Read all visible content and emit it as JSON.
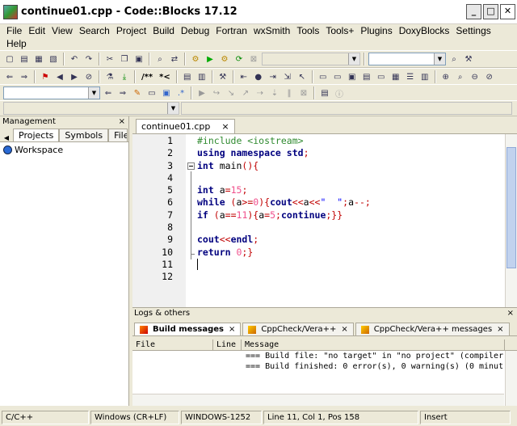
{
  "window": {
    "title": "continue01.cpp - Code::Blocks 17.12",
    "min": "_",
    "max": "□",
    "close": "✕"
  },
  "menu": [
    "File",
    "Edit",
    "View",
    "Search",
    "Project",
    "Build",
    "Debug",
    "Fortran",
    "wxSmith",
    "Tools",
    "Tools+",
    "Plugins",
    "DoxyBlocks",
    "Settings",
    "Help"
  ],
  "toolbar": {
    "doxy_comment_label": "/**",
    "doxy_line_label": "*<"
  },
  "management": {
    "title": "Management",
    "close": "×",
    "tabs": [
      "Projects",
      "Symbols",
      "File"
    ],
    "workspace_label": "Workspace"
  },
  "editor": {
    "tab_label": "continue01.cpp",
    "tab_close": "×",
    "lines": [
      {
        "num": "1",
        "tokens": [
          {
            "t": "#include <iostream>",
            "c": "pp"
          }
        ]
      },
      {
        "num": "2",
        "tokens": [
          {
            "t": "using namespace ",
            "c": "kw"
          },
          {
            "t": "std",
            "c": "kw"
          },
          {
            "t": ";",
            "c": "op"
          }
        ]
      },
      {
        "num": "3",
        "tokens": [
          {
            "t": "int",
            "c": "kw"
          },
          {
            "t": " main",
            "c": "id"
          },
          {
            "t": "(){",
            "c": "op"
          }
        ]
      },
      {
        "num": "4",
        "tokens": []
      },
      {
        "num": "5",
        "tokens": [
          {
            "t": "int",
            "c": "kw"
          },
          {
            "t": " a",
            "c": "id"
          },
          {
            "t": "=",
            "c": "op"
          },
          {
            "t": "15",
            "c": "num"
          },
          {
            "t": ";",
            "c": "op"
          }
        ]
      },
      {
        "num": "6",
        "tokens": [
          {
            "t": "while",
            "c": "kw"
          },
          {
            "t": " (",
            "c": "op"
          },
          {
            "t": "a",
            "c": "id"
          },
          {
            "t": ">=",
            "c": "op"
          },
          {
            "t": "0",
            "c": "num"
          },
          {
            "t": "){",
            "c": "op"
          },
          {
            "t": "cout",
            "c": "kw"
          },
          {
            "t": "<<",
            "c": "op"
          },
          {
            "t": "a",
            "c": "id"
          },
          {
            "t": "<<",
            "c": "op"
          },
          {
            "t": "\"  \"",
            "c": "str"
          },
          {
            "t": ";",
            "c": "op"
          },
          {
            "t": "a",
            "c": "id"
          },
          {
            "t": "--;",
            "c": "op"
          }
        ]
      },
      {
        "num": "7",
        "tokens": [
          {
            "t": "if",
            "c": "kw"
          },
          {
            "t": " (",
            "c": "op"
          },
          {
            "t": "a",
            "c": "id"
          },
          {
            "t": "==",
            "c": "op"
          },
          {
            "t": "11",
            "c": "num"
          },
          {
            "t": "){",
            "c": "op"
          },
          {
            "t": "a",
            "c": "id"
          },
          {
            "t": "=",
            "c": "op"
          },
          {
            "t": "5",
            "c": "num"
          },
          {
            "t": ";",
            "c": "op"
          },
          {
            "t": "continue",
            "c": "kw"
          },
          {
            "t": ";}}",
            "c": "op"
          }
        ]
      },
      {
        "num": "8",
        "tokens": []
      },
      {
        "num": "9",
        "tokens": [
          {
            "t": "cout",
            "c": "kw"
          },
          {
            "t": "<<",
            "c": "op"
          },
          {
            "t": "endl",
            "c": "kw"
          },
          {
            "t": ";",
            "c": "op"
          }
        ]
      },
      {
        "num": "10",
        "tokens": [
          {
            "t": "return",
            "c": "kw"
          },
          {
            "t": " ",
            "c": "id"
          },
          {
            "t": "0",
            "c": "num"
          },
          {
            "t": ";}",
            "c": "op"
          }
        ]
      },
      {
        "num": "11",
        "tokens": []
      },
      {
        "num": "12",
        "tokens": [
          {
            "t": "",
            "c": "cmt"
          }
        ]
      }
    ]
  },
  "logs": {
    "title": "Logs & others",
    "close": "×",
    "tabs": [
      {
        "label": "Build messages",
        "close": "×"
      },
      {
        "label": "CppCheck/Vera++",
        "close": "×"
      },
      {
        "label": "CppCheck/Vera++ messages",
        "close": "×"
      }
    ],
    "columns": [
      "File",
      "Line",
      "Message"
    ],
    "rows": [
      "=== Build file: \"no target\" in \"no project\" (compiler",
      "=== Build finished: 0 error(s), 0 warning(s) (0 minut"
    ]
  },
  "status": {
    "language": "C/C++",
    "eol": "Windows (CR+LF)",
    "encoding": "WINDOWS-1252",
    "position": "Line 11, Col 1, Pos 158",
    "mode": "Insert"
  }
}
